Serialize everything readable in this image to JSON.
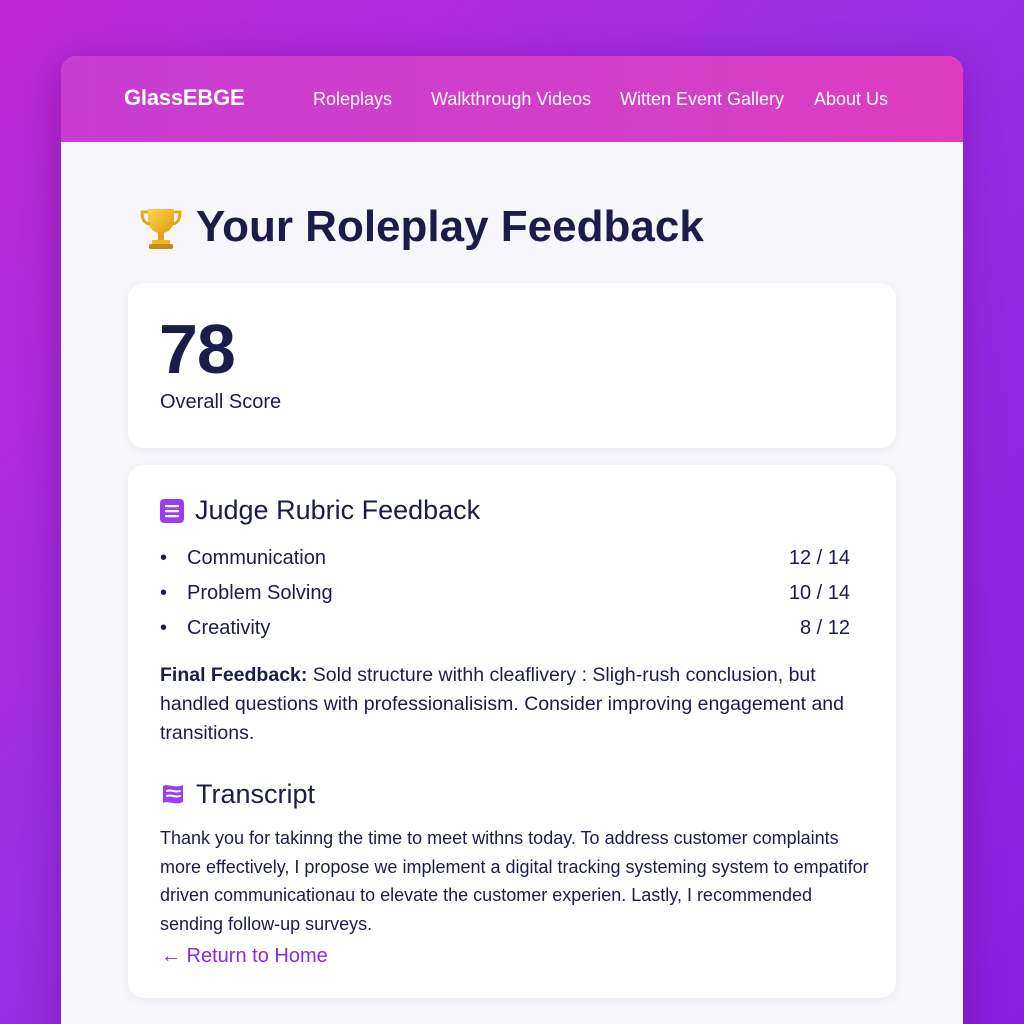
{
  "nav": {
    "brand": "GlassEBGE",
    "links": [
      "Roleplays",
      "Walkthrough Videos",
      "Witten Event Gallery",
      "About Us"
    ]
  },
  "page": {
    "title": "Your Roleplay Feedback",
    "title_icon": "trophy-icon"
  },
  "score": {
    "value": "78",
    "label": "Overall Score"
  },
  "rubric": {
    "heading": "Judge Rubric Feedback",
    "heading_icon": "list-icon",
    "items": [
      {
        "name": "Communication",
        "score": "12 / 14"
      },
      {
        "name": "Problem Solving",
        "score": "10 / 14"
      },
      {
        "name": "Creativity",
        "score": "8 / 12"
      }
    ]
  },
  "final_feedback": {
    "label": "Final Feedback:",
    "text": " Sold structure withh cleaflivery : Sligh-rush conclusion, but handled questions with professionalisism. Consider improving engagement and transitions."
  },
  "transcript": {
    "heading": "Transcript",
    "heading_icon": "flag-icon",
    "text": "Thank you for takinng the time to meet withns today. To address customer complaints more effectively, I propose we implement a digital tracking systeming system to empatifor driven communicationau to elevate the customer experien. Lastly, I recommended sending follow-up surveys."
  },
  "return_link": "← Return to Home",
  "colors": {
    "accent": "#8a2be2",
    "nav_gradient_start": "#c93cd2",
    "nav_gradient_end": "#e03bbd",
    "text_dark": "#1c1c4a",
    "background_start": "#c026d3",
    "background_end": "#8b1fe0"
  }
}
